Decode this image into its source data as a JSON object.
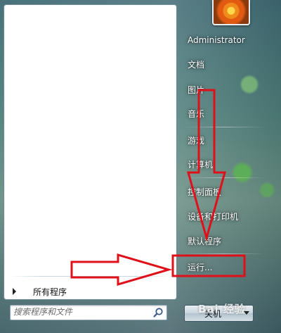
{
  "start_menu": {
    "all_programs_label": "所有程序",
    "search": {
      "placeholder": "搜索程序和文件",
      "value": ""
    },
    "user": {
      "name": "Administrator"
    },
    "right_items": [
      {
        "label": "文档"
      },
      {
        "label": "图片"
      },
      {
        "label": "音乐"
      },
      {
        "label": "游戏"
      },
      {
        "label": "计算机"
      },
      {
        "label": "控制面板"
      },
      {
        "label": "设备和打印机"
      },
      {
        "label": "默认程序"
      },
      {
        "label": "运行..."
      }
    ],
    "shutdown_label": "关机"
  },
  "watermark": {
    "text": "Bai 经验"
  },
  "colors": {
    "annotation_red": "#e0101a",
    "panel_bg": "#ffffff",
    "glass": "#4f7f7a"
  },
  "icons": [
    "user-avatar-flower",
    "search-icon",
    "all-programs-arrow-icon",
    "shutdown-options-arrow-icon"
  ]
}
